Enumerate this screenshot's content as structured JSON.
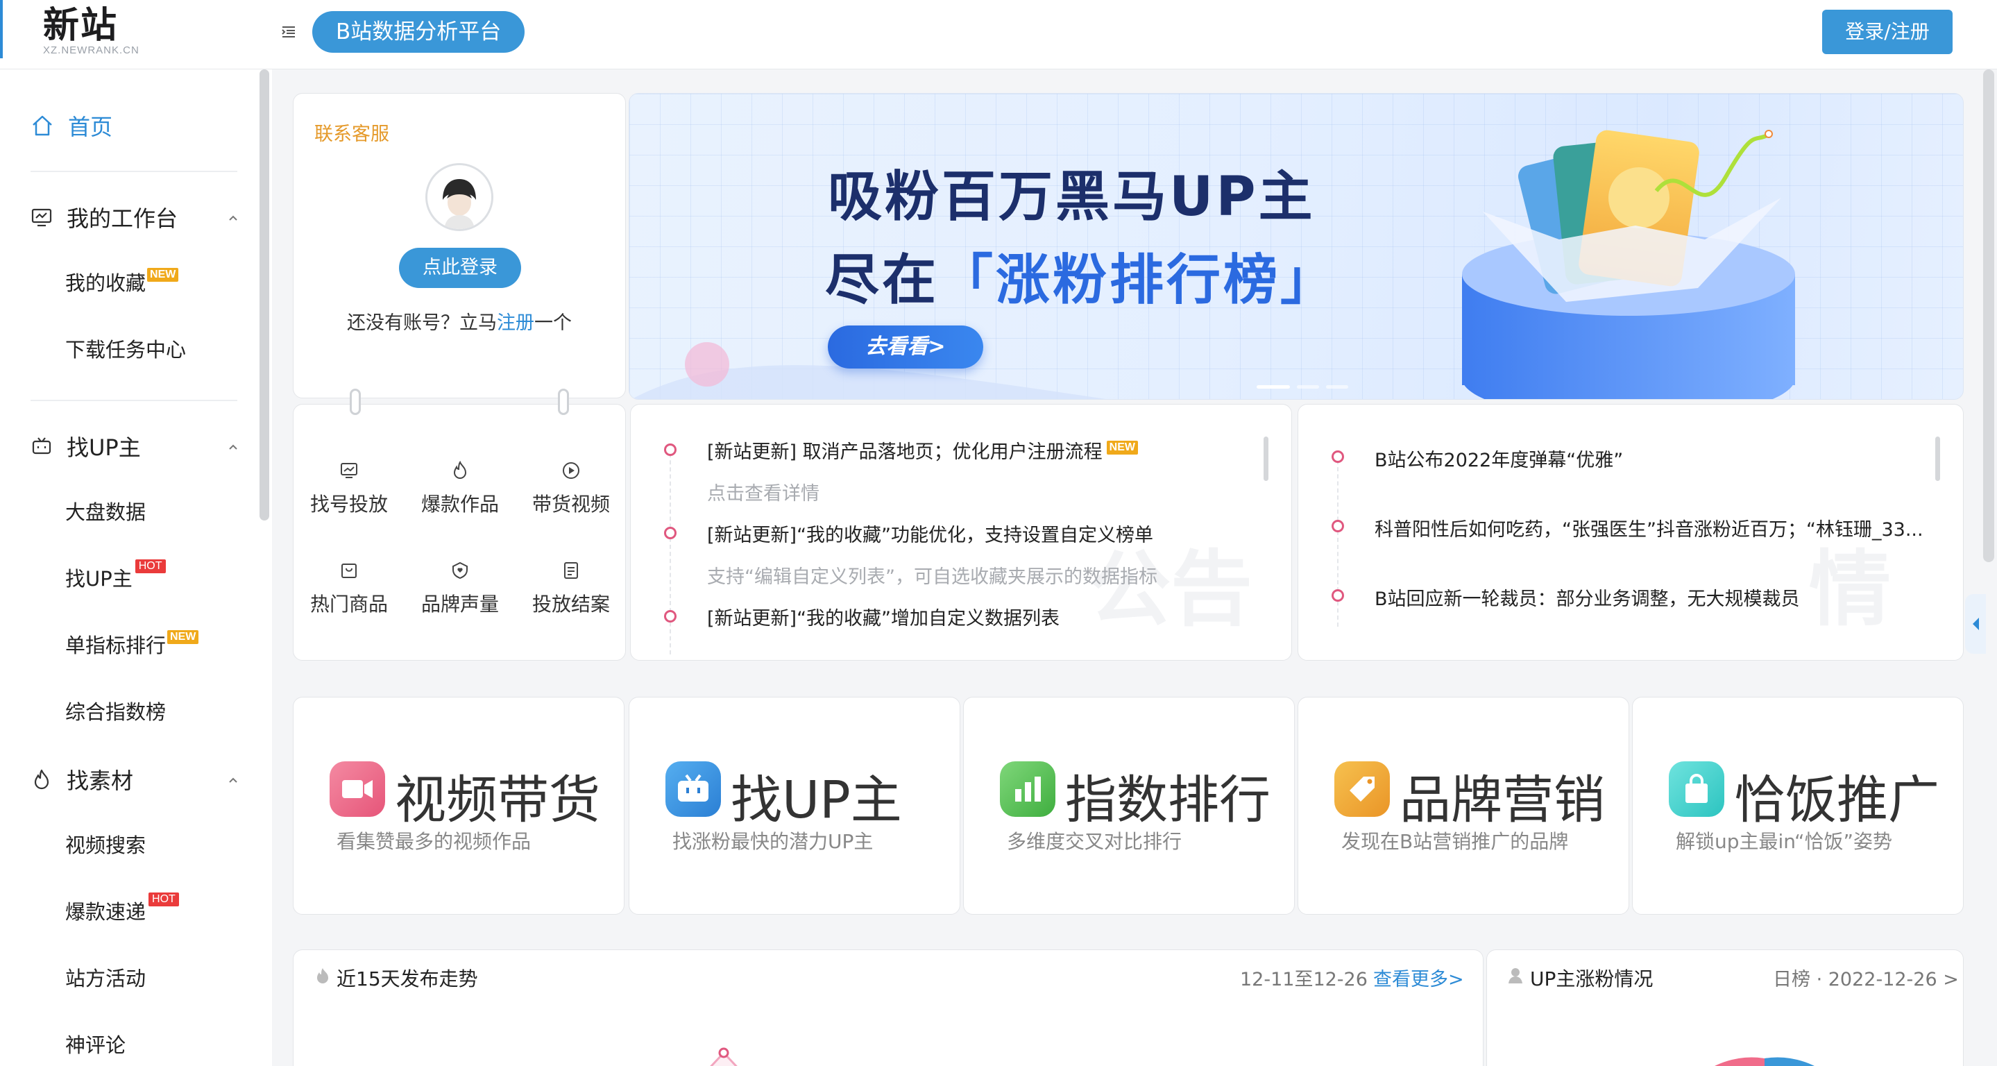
{
  "header": {
    "logo_main": "新站",
    "logo_sub": "XZ.NEWRANK.CN",
    "platform": "B站数据分析平台",
    "login": "登录/注册"
  },
  "sidebar": {
    "home": "首页",
    "groups": [
      {
        "label": "我的工作台",
        "icon": "workbench-icon",
        "items": [
          {
            "label": "我的收藏",
            "badge": "NEW"
          },
          {
            "label": "下载任务中心",
            "badge": ""
          }
        ]
      },
      {
        "label": "找UP主",
        "icon": "tv-icon",
        "items": [
          {
            "label": "大盘数据",
            "badge": ""
          },
          {
            "label": "找UP主",
            "badge": "HOT"
          },
          {
            "label": "单指标排行",
            "badge": "NEW"
          },
          {
            "label": "综合指数榜",
            "badge": ""
          }
        ]
      },
      {
        "label": "找素材",
        "icon": "flame-icon",
        "items": [
          {
            "label": "视频搜索",
            "badge": ""
          },
          {
            "label": "爆款速递",
            "badge": "HOT"
          },
          {
            "label": "站方活动",
            "badge": ""
          },
          {
            "label": "神评论",
            "badge": ""
          }
        ]
      }
    ]
  },
  "login_card": {
    "service": "联系客服",
    "login_button": "点此登录",
    "no_account_prefix": "还没有账号？立马",
    "register": "注册",
    "no_account_suffix": "一个"
  },
  "quick_links": [
    {
      "label": "找号投放",
      "icon": "chart-screen-icon"
    },
    {
      "label": "爆款作品",
      "icon": "flame-icon"
    },
    {
      "label": "带货视频",
      "icon": "play-circle-icon"
    },
    {
      "label": "热门商品",
      "icon": "bag-icon"
    },
    {
      "label": "品牌声量",
      "icon": "heart-shield-icon"
    },
    {
      "label": "投放结案",
      "icon": "document-icon"
    }
  ],
  "banner": {
    "line1": "吸粉百万黑马UP主",
    "line2_prefix": "尽在",
    "line2_highlight": "「涨粉排行榜」",
    "button": "去看看>"
  },
  "announcements": {
    "watermark": "公告",
    "items": [
      {
        "title": "[新站更新] 取消产品落地页；优化用户注册流程",
        "badge": "NEW",
        "sub": "点击查看详情"
      },
      {
        "title": "[新站更新]“我的收藏”功能优化，支持设置自定义榜单",
        "badge": "",
        "sub": "支持“编辑自定义列表”，可自选收藏夹展示的数据指标"
      },
      {
        "title": "[新站更新]“我的收藏”增加自定义数据列表",
        "badge": "",
        "sub": ""
      }
    ]
  },
  "intel": {
    "watermark": "情报",
    "items": [
      "B站公布2022年度弹幕“优雅”",
      "科普阳性后如何吃药，“张强医生”抖音涨粉近百万；“林钰珊_33...",
      "B站回应新一轮裁员：部分业务调整，无大规模裁员"
    ]
  },
  "features": [
    {
      "title": "视频带货",
      "desc": "看集赞最多的视频作品",
      "icon": "video-camera-icon",
      "color": "#f06c8a"
    },
    {
      "title": "找UP主",
      "desc": "找涨粉最快的潜力UP主",
      "icon": "tv-icon",
      "color": "#3a97e3"
    },
    {
      "title": "指数排行",
      "desc": "多维度交叉对比排行",
      "icon": "bar-chart-icon",
      "color": "#5cc45a"
    },
    {
      "title": "品牌营销",
      "desc": "发现在B站营销推广的品牌",
      "icon": "tag-icon",
      "color": "#f1a93a"
    },
    {
      "title": "恰饭推广",
      "desc": "解锁up主最in“恰饭”姿势",
      "icon": "shopping-bag-icon",
      "color": "#3fd3cf"
    }
  ],
  "trend": {
    "title": "近15天发布走势",
    "range": "12-11至12-26",
    "more": "查看更多>"
  },
  "growth": {
    "title": "UP主涨粉情况",
    "meta": "日榜 · 2022-12-26 >"
  }
}
